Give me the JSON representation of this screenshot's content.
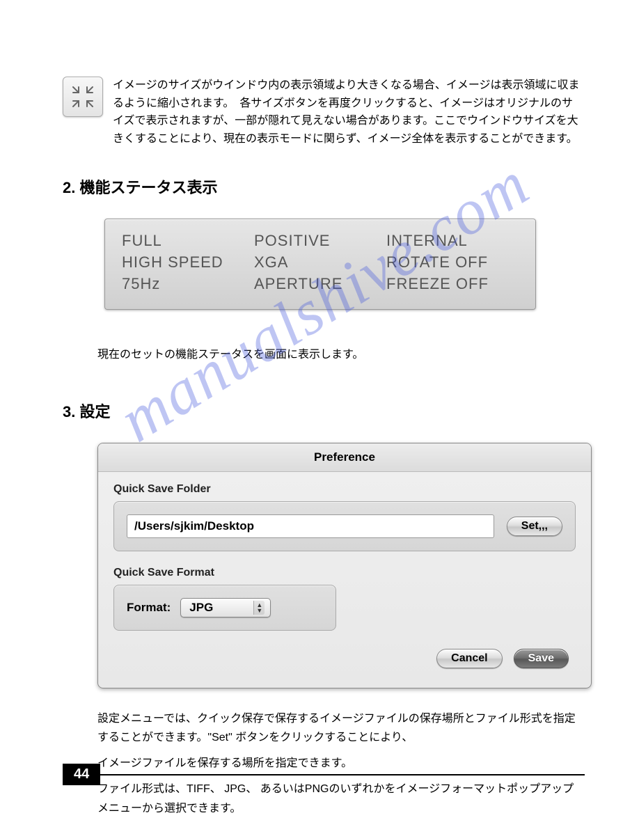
{
  "intro_text": "イメージのサイズがウインドウ内の表示領域より大きくなる場合、イメージは表示領域に収まるように縮小されます。　各サイズボタンを再度クリックすると、イメージはオリジナルのサイズで表示されますが、一部が隠れて見えない場合があります。ここでウインドウサイズを大きくすることにより、現在の表示モードに関らず、イメージ全体を表示することができます。",
  "section2_heading": "2. 機能ステータス表示",
  "status": {
    "col1": [
      "FULL",
      "HIGH SPEED",
      "75Hz"
    ],
    "col2": [
      "POSITIVE",
      "XGA",
      "APERTURE"
    ],
    "col3": [
      "INTERNAL",
      "ROTATE OFF",
      "FREEZE OFF"
    ]
  },
  "status_desc": "現在のセットの機能ステータスを画面に表示します。",
  "section3_heading": "3. 設定",
  "preference": {
    "title": "Preference",
    "folder_label": "Quick Save Folder",
    "folder_path": "/Users/sjkim/Desktop",
    "set_button": "Set,,,",
    "format_group_label": "Quick Save Format",
    "format_label": "Format:",
    "format_value": "JPG",
    "cancel": "Cancel",
    "save": "Save"
  },
  "settings_p1": "設定メニューでは、クイック保存で保存するイメージファイルの保存場所とファイル形式を指定することができます。\"Set\" ボタンをクリックすることにより、",
  "settings_p2": "イメージファイルを保存する場所を指定できます。",
  "settings_p3": "ファイル形式は、TIFF、 JPG、 あるいはPNGのいずれかをイメージフォーマットポップアップメニューから選択できます。",
  "page_number": "44",
  "watermark": "manualshive.com"
}
